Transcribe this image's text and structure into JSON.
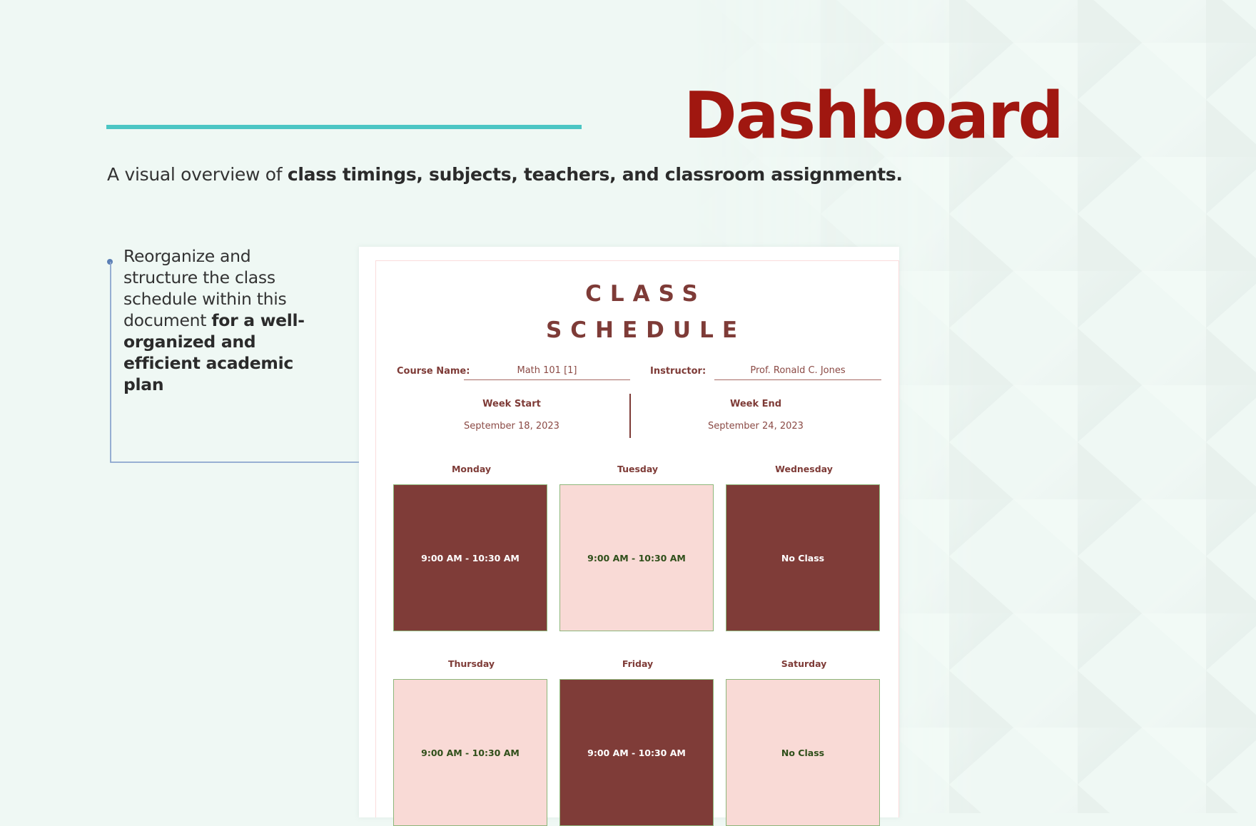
{
  "header": {
    "title": "Dashboard",
    "subtitle_plain": "A visual overview of ",
    "subtitle_bold": "class timings, subjects, teachers, and classroom assignments."
  },
  "note": {
    "plain": "Reorganize and structure the class schedule within this document ",
    "bold": "for a well-organized and efficient academic plan"
  },
  "document": {
    "title_line1": "CLASS",
    "title_line2": "SCHEDULE",
    "course_name_label": "Course Name:",
    "course_name_value": "Math 101 [1]",
    "instructor_label": "Instructor:",
    "instructor_value": "Prof. Ronald C. Jones",
    "week_start_label": "Week Start",
    "week_start_value": "September 18, 2023",
    "week_end_label": "Week End",
    "week_end_value": "September 24, 2023",
    "days": [
      {
        "day": "Monday",
        "slot": "9:00 AM - 10:30 AM",
        "style": "dark"
      },
      {
        "day": "Tuesday",
        "slot": "9:00 AM - 10:30 AM",
        "style": "light"
      },
      {
        "day": "Wednesday",
        "slot": "No Class",
        "style": "dark"
      },
      {
        "day": "Thursday",
        "slot": "9:00 AM - 10:30 AM",
        "style": "light"
      },
      {
        "day": "Friday",
        "slot": "9:00 AM - 10:30 AM",
        "style": "dark"
      },
      {
        "day": "Saturday",
        "slot": "No Class",
        "style": "light"
      }
    ]
  },
  "colors": {
    "accent_teal": "#4CC6C4",
    "title_red": "#A01710",
    "doc_maroon": "#7E3B37",
    "box_dark": "#7F3C38",
    "box_light": "#F9DAD6",
    "box_border": "#8DB77A",
    "connector_blue": "#5B7FB5",
    "background": "#EFF8F4"
  }
}
